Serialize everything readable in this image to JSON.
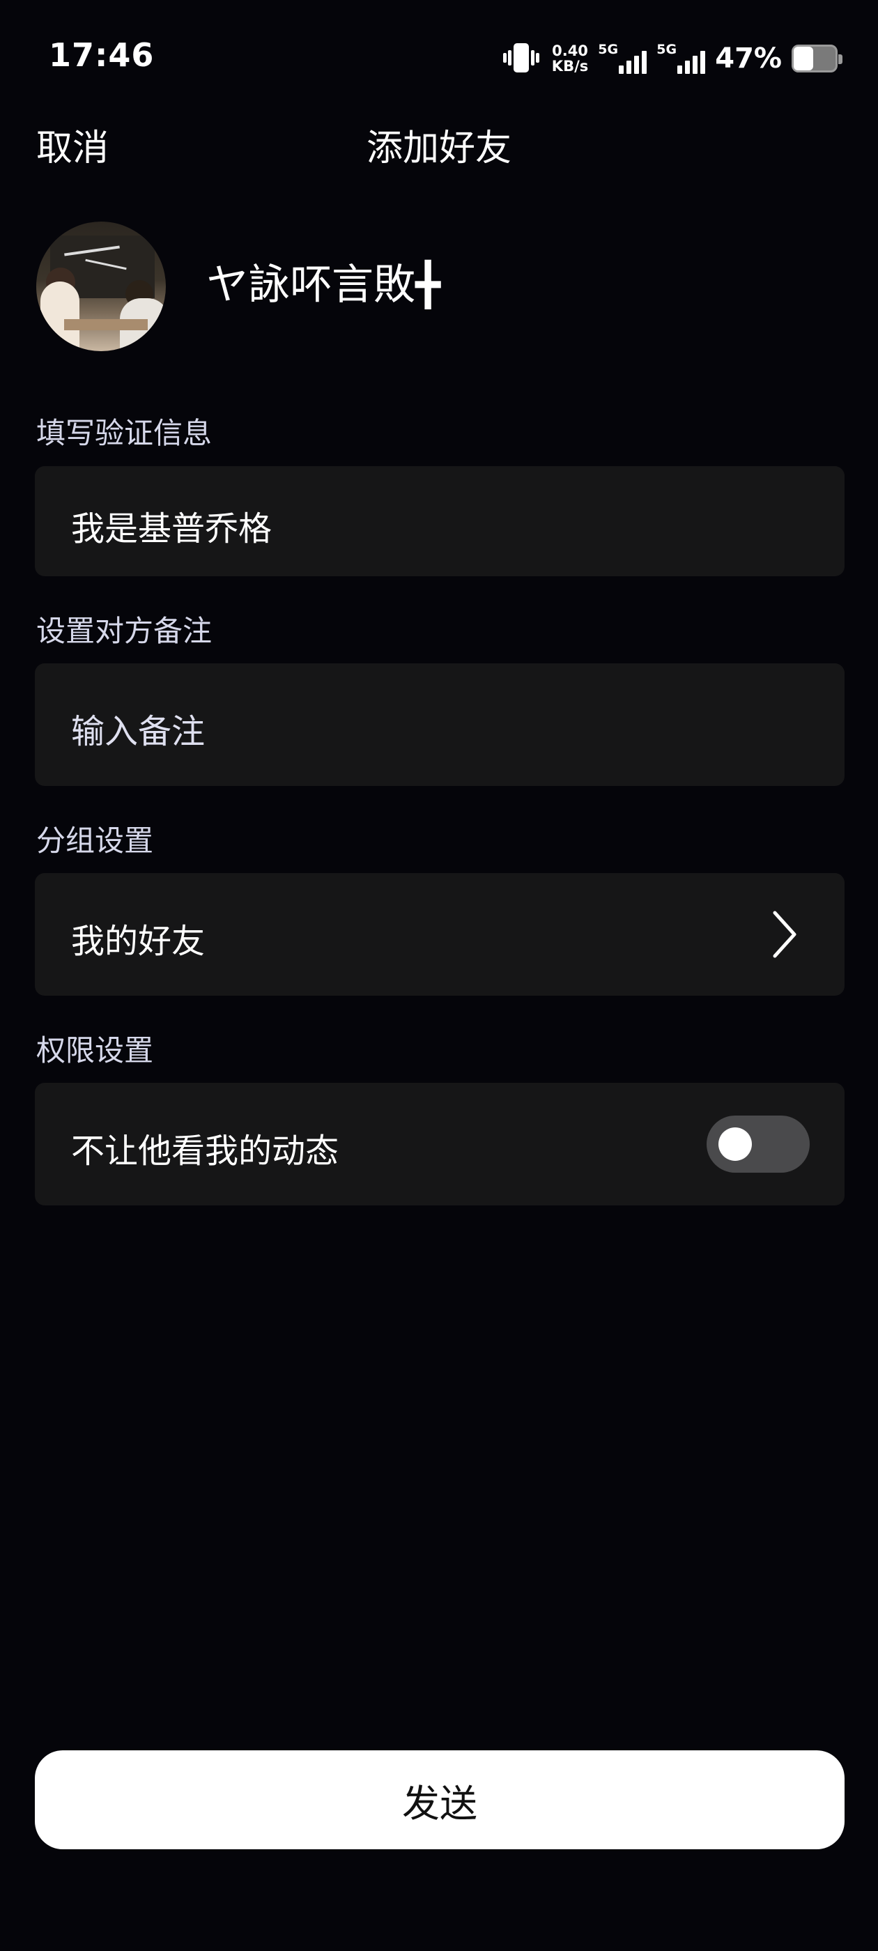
{
  "status_bar": {
    "time": "17:46",
    "net_speed_value": "0.40",
    "net_speed_unit": "KB/s",
    "sim1_label": "5G",
    "sim2_label": "5G",
    "battery_percent": "47%",
    "battery_level": 0.47,
    "icons": [
      "vibrate-icon",
      "signal-icon",
      "signal-icon",
      "battery-icon"
    ]
  },
  "nav": {
    "cancel_label": "取消",
    "title": "添加好友"
  },
  "profile": {
    "nickname": "ヤ詠吥言敗╋"
  },
  "verification": {
    "label": "填写验证信息",
    "value": "我是基普乔格"
  },
  "remark": {
    "label": "设置对方备注",
    "placeholder": "输入备注"
  },
  "group": {
    "label": "分组设置",
    "value": "我的好友",
    "icon": "chevron-right-icon"
  },
  "permission": {
    "label": "权限设置",
    "option_label": "不让他看我的动态",
    "toggle_on": false
  },
  "actions": {
    "send_label": "发送"
  },
  "colors": {
    "background": "#05050a",
    "card": "#161617",
    "toggle_off": "#4a4a4c",
    "button": "#ffffff"
  }
}
